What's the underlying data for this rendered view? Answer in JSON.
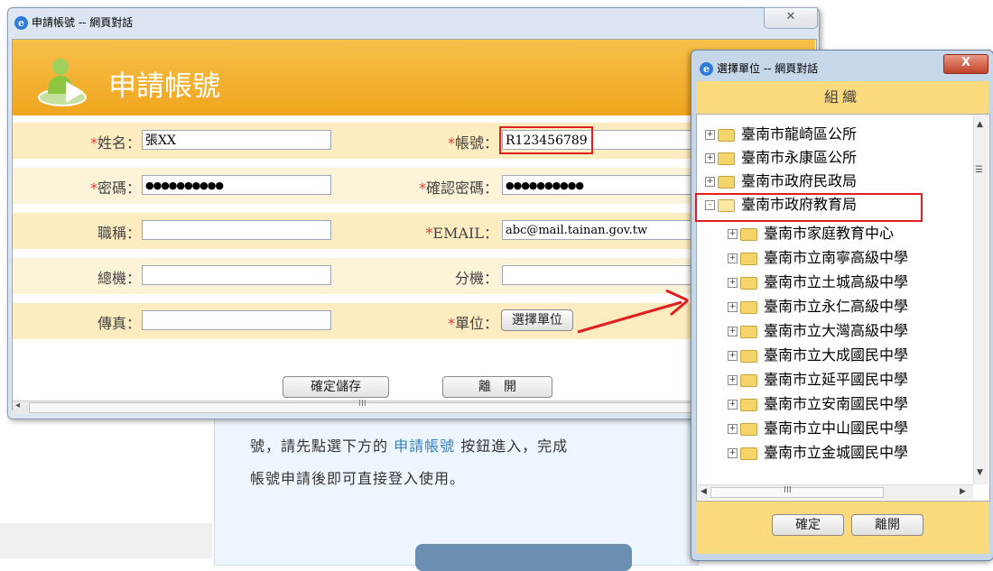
{
  "background": {
    "line1_prefix": "號，請先點選下方的",
    "line1_link": "申請帳號",
    "line1_suffix": "按鈕進入，完成",
    "line2": "帳號申請後即可直接登入使用。"
  },
  "main_dialog": {
    "title": "申請帳號 -- 網頁對話",
    "header_title": "申請帳號",
    "fields": {
      "name_label": "姓名：",
      "name_value": "張XX",
      "account_label": "帳號：",
      "account_value": "R123456789",
      "password_label": "密碼：",
      "password_value": "●●●●●●●●●●",
      "confirm_label": "確認密碼：",
      "confirm_value": "●●●●●●●●●●",
      "title_label": "職稱：",
      "email_label": "EMAIL：",
      "email_value": "abc@mail.tainan.gov.tw",
      "switchboard_label": "總機：",
      "extension_label": "分機：",
      "fax_label": "傳真：",
      "unit_label": "單位：",
      "required_mark": "*"
    },
    "select_unit_button": "選擇單位",
    "save_button": "確定儲存",
    "leave_button": "離　開",
    "scroll_grip": "III"
  },
  "unit_dialog": {
    "title": "選擇單位 -- 網頁對話",
    "close": "X",
    "header": "組織",
    "tree": [
      {
        "label": "臺南市龍崎區公所",
        "level": 0,
        "expander": "+"
      },
      {
        "label": "臺南市永康區公所",
        "level": 0,
        "expander": "+"
      },
      {
        "label": "臺南市政府民政局",
        "level": 0,
        "expander": "+"
      },
      {
        "label": "臺南市政府教育局",
        "level": 0,
        "expander": "-",
        "selected": true
      },
      {
        "label": "臺南市家庭教育中心",
        "level": 1,
        "expander": "+"
      },
      {
        "label": "臺南市立南寧高級中學",
        "level": 1,
        "expander": "+"
      },
      {
        "label": "臺南市立土城高級中學",
        "level": 1,
        "expander": "+"
      },
      {
        "label": "臺南市立永仁高級中學",
        "level": 1,
        "expander": "+"
      },
      {
        "label": "臺南市立大灣高級中學",
        "level": 1,
        "expander": "+"
      },
      {
        "label": "臺南市立大成國民中學",
        "level": 1,
        "expander": "+"
      },
      {
        "label": "臺南市立延平國民中學",
        "level": 1,
        "expander": "+"
      },
      {
        "label": "臺南市立安南國民中學",
        "level": 1,
        "expander": "+"
      },
      {
        "label": "臺南市立中山國民中學",
        "level": 1,
        "expander": "+"
      },
      {
        "label": "臺南市立金城國民中學",
        "level": 1,
        "expander": "+"
      }
    ],
    "scroll_grip": "III",
    "ok_button": "確定",
    "leave_button": "離開"
  },
  "colors": {
    "header_orange": "#f0a51e",
    "row_light": "#fdf3d9",
    "highlight_red": "#e02020"
  }
}
